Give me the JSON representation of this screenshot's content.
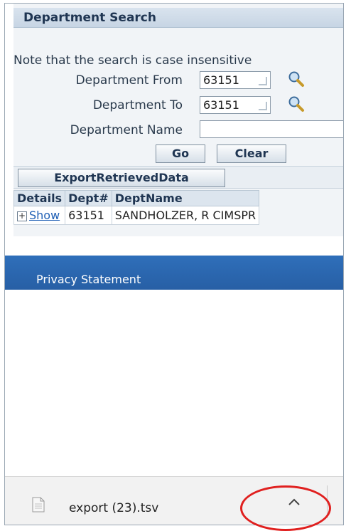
{
  "search_panel": {
    "title": "Department Search",
    "note": "Note that the search is case insensitive",
    "dept_from": {
      "label": "Department From",
      "value": "63151"
    },
    "dept_to": {
      "label": "Department To",
      "value": "63151"
    },
    "dept_name": {
      "label": "Department Name",
      "value": ""
    },
    "go_label": "Go",
    "clear_label": "Clear"
  },
  "export_label": "ExportRetrievedData",
  "results": {
    "headers": [
      "Details",
      "Dept#",
      "DeptName"
    ],
    "rows": [
      {
        "expand": "+",
        "details_link": "Show",
        "dept": "63151",
        "name": "SANDHOLZER, R CIMSPR"
      }
    ]
  },
  "footer": {
    "privacy": "Privacy Statement"
  },
  "downloads": {
    "file_name": "export (23).tsv"
  },
  "colors": {
    "accent_blue": "#2f6fba",
    "highlight_ring": "#e0201f"
  },
  "icons": [
    "search-icon",
    "expand-icon",
    "file-icon",
    "chevron-up-icon"
  ]
}
